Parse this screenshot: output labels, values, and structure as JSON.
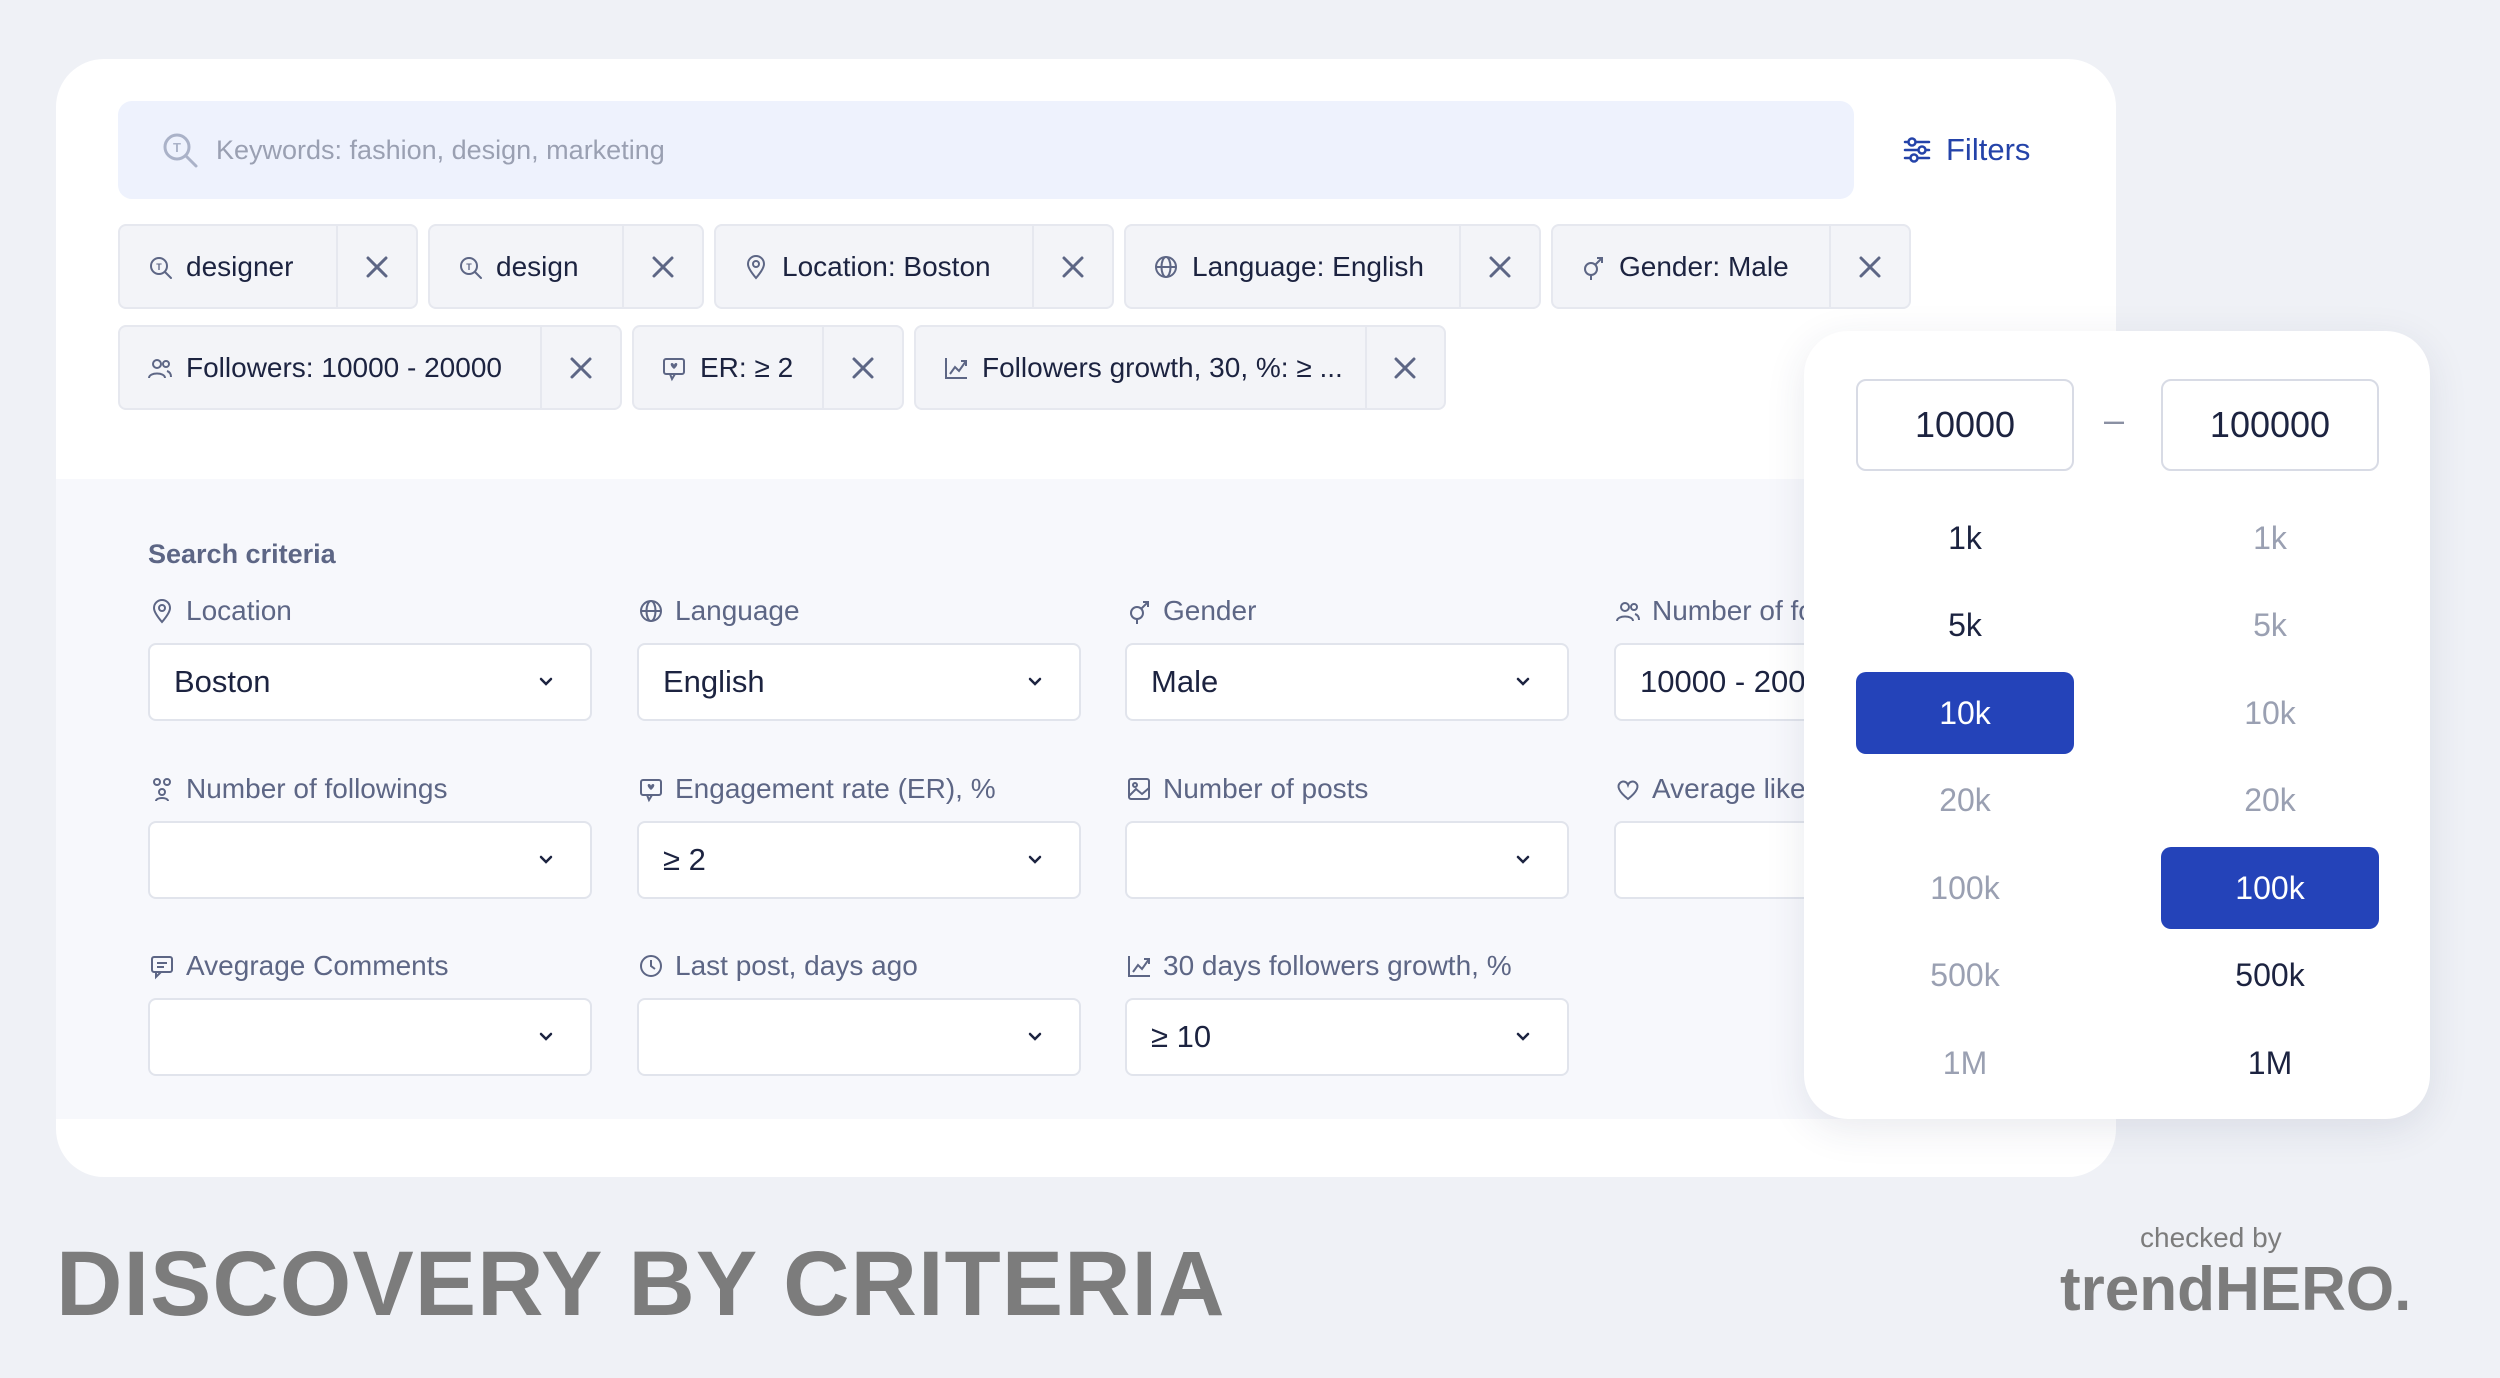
{
  "search": {
    "placeholder": "Keywords: fashion, design, marketing"
  },
  "filters": {
    "label": "Filters"
  },
  "chips": {
    "row1": [
      {
        "label": "designer",
        "icon": "keyword-icon"
      },
      {
        "label": "design",
        "icon": "keyword-icon"
      },
      {
        "label": "Location: Boston",
        "icon": "location-pin-icon"
      },
      {
        "label": "Language: English",
        "icon": "globe-icon"
      },
      {
        "label": "Gender: Male",
        "icon": "gender-icon"
      }
    ],
    "row2": [
      {
        "label": "Followers: 10000 - 20000",
        "icon": "users-icon"
      },
      {
        "label": "ER: ≥ 2",
        "icon": "engagement-icon"
      },
      {
        "label": "Followers growth, 30, %: ≥ ...",
        "icon": "growth-chart-icon"
      }
    ]
  },
  "criteria": {
    "title": "Search criteria",
    "fields": [
      {
        "label": "Location",
        "value": "Boston",
        "icon": "location-pin-icon"
      },
      {
        "label": "Language",
        "value": "English",
        "icon": "globe-icon"
      },
      {
        "label": "Gender",
        "value": "Male",
        "icon": "gender-icon"
      },
      {
        "label": "Number of fo",
        "value": "10000 - 200",
        "icon": "users-icon"
      },
      {
        "label": "Number of followings",
        "value": "",
        "icon": "followings-icon"
      },
      {
        "label": "Engagement rate (ER), %",
        "value": "≥ 2",
        "icon": "engagement-icon"
      },
      {
        "label": "Number of posts",
        "value": "",
        "icon": "image-icon"
      },
      {
        "label": "Average like",
        "value": "",
        "icon": "heart-icon"
      },
      {
        "label": "Avegrage Comments",
        "value": "",
        "icon": "comment-icon"
      },
      {
        "label": "Last post, days ago",
        "value": "",
        "icon": "clock-icon"
      },
      {
        "label": "30 days followers growth, %",
        "value": "≥ 10",
        "icon": "growth-chart-icon"
      }
    ]
  },
  "range_popup": {
    "min_value": "10000",
    "max_value": "100000",
    "separator": "–",
    "min_options": [
      "1k",
      "5k",
      "10k",
      "20k",
      "100k",
      "500k",
      "1M"
    ],
    "max_options": [
      "1k",
      "5k",
      "10k",
      "20k",
      "100k",
      "500k",
      "1M"
    ],
    "min_selected": "10k",
    "max_selected": "100k"
  },
  "footer": {
    "headline": "DISCOVERY BY CRITERIA",
    "checked_by": "checked by",
    "brand": "trendHERO."
  },
  "colors": {
    "accent": "#2443b9",
    "background": "#eff1f6",
    "text": "#1c2340",
    "muted": "#5d6685"
  }
}
